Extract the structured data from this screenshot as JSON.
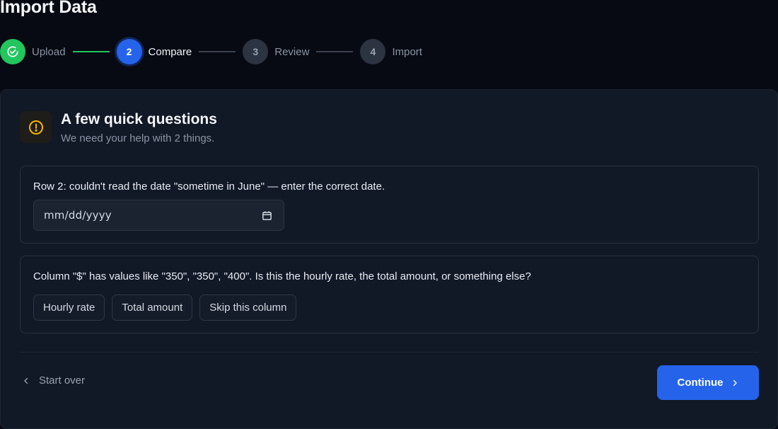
{
  "page": {
    "title": "Import Data"
  },
  "stepper": {
    "steps": [
      {
        "number": "",
        "label": "Upload",
        "state": "done"
      },
      {
        "number": "2",
        "label": "Compare",
        "state": "active"
      },
      {
        "number": "3",
        "label": "Review",
        "state": "pending"
      },
      {
        "number": "4",
        "label": "Import",
        "state": "pending"
      }
    ]
  },
  "card": {
    "title": "A few quick questions",
    "subtitle": "We need your help with 2 things.",
    "icon": "alert-circle-icon",
    "questions": [
      {
        "text": "Row 2: couldn't read the date \"sometime in June\" — enter the correct date.",
        "input": {
          "type": "date",
          "placeholder": "mm/dd/yyyy",
          "value": ""
        }
      },
      {
        "text": "Column \"$\" has values like \"350\", \"350\", \"400\". Is this the hourly rate, the total amount, or something else?",
        "options": [
          "Hourly rate",
          "Total amount",
          "Skip this column"
        ]
      }
    ]
  },
  "footer": {
    "start_over_label": "Start over",
    "continue_label": "Continue"
  },
  "colors": {
    "accent": "#2563eb",
    "success": "#22c55e",
    "warning": "#f5b400",
    "background": "#070a12",
    "card": "#111826"
  }
}
